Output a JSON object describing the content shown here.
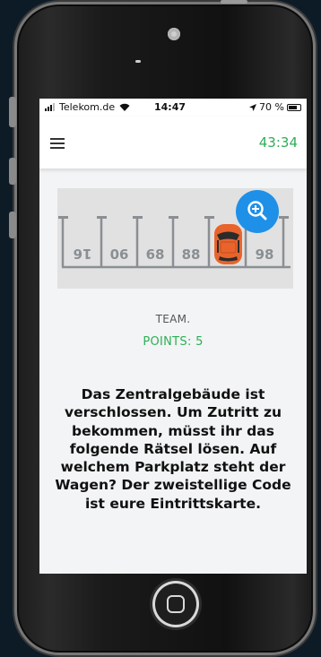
{
  "status_bar": {
    "carrier": "Telekom.de",
    "time": "14:47",
    "battery": "70 %"
  },
  "header": {
    "timer": "43:34"
  },
  "parking_image": {
    "spot_numbers": [
      "16",
      "06",
      "68",
      "88",
      "",
      "98"
    ]
  },
  "team": {
    "label": "TEAM.",
    "points": "POINTS: 5"
  },
  "question": {
    "text": "Das Zentralgebäude ist verschlossen. Um Zutritt zu bekommen, müsst ihr das folgende Rätsel lösen. Auf welchem Parkplatz steht der Wagen? Der zweistellige Code ist eure Eintrittskarte."
  },
  "colors": {
    "accent_green": "#2eae55",
    "zoom_blue": "#1e90e8",
    "car_orange": "#e8642c"
  }
}
